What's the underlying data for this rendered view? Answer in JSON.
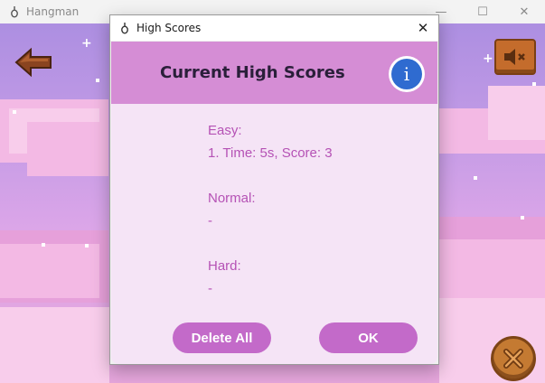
{
  "main_window": {
    "title": "Hangman",
    "controls": {
      "minimize": "—",
      "maximize": "☐",
      "close": "✕"
    }
  },
  "dialog": {
    "title": "High Scores",
    "close_glyph": "✕",
    "heading": "Current High Scores",
    "info_glyph": "i",
    "sections": {
      "easy": {
        "label": "Easy:",
        "entry": "1. Time: 5s, Score: 3"
      },
      "normal": {
        "label": "Normal:",
        "entry": "-"
      },
      "hard": {
        "label": "Hard:",
        "entry": "-"
      }
    },
    "buttons": {
      "delete_all": "Delete All",
      "ok": "OK"
    }
  },
  "icons": {
    "app": "hangman-icon",
    "back": "back-arrow-icon",
    "mute": "speaker-muted-icon",
    "exit": "exit-x-icon",
    "info": "info-icon"
  },
  "colors": {
    "header_bg": "#d58dd5",
    "content_bg": "#f5e4f6",
    "button_bg": "#c36ac9",
    "score_text": "#b552b5",
    "info_blue": "#2f6bd0"
  }
}
